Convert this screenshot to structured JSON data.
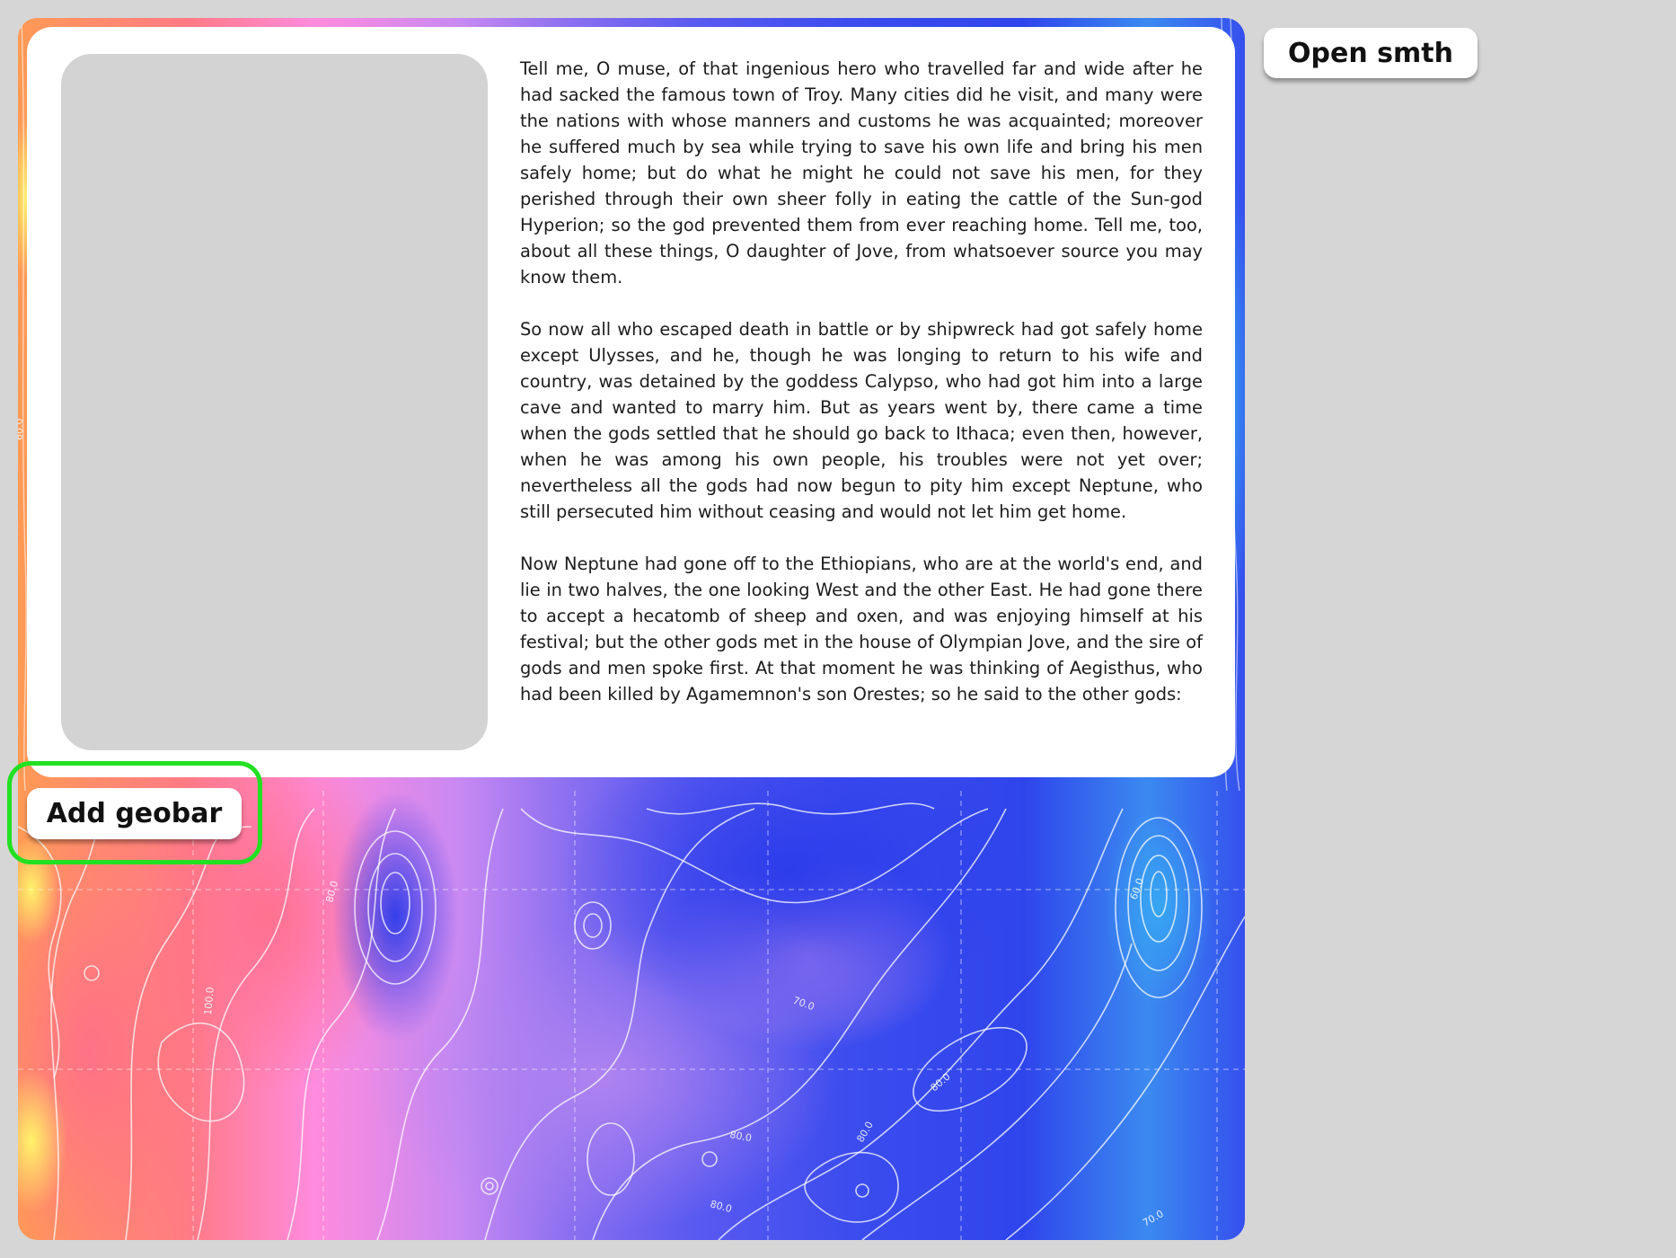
{
  "toolbar": {
    "open_label": "Open smth",
    "add_geobar_label": "Add geobar"
  },
  "article": {
    "paragraphs": [
      "Tell me, O muse, of that ingenious hero who travelled far and wide after he had sacked the famous town of Troy. Many cities did he visit, and many were the nations with whose manners and customs he was acquainted; moreover he suffered much by sea while trying to save his own life and bring his men safely home; but do what he might he could not save his men, for they perished through their own sheer folly in eating the cattle of the Sun-god Hyperion; so the god prevented them from ever reaching home. Tell me, too, about all these things, O daughter of Jove, from whatsoever source you may know them.",
      "So now all who escaped death in battle or by shipwreck had got safely home except Ulysses, and he, though he was longing to return to his wife and country, was detained by the goddess Calypso, who had got him into a large cave and wanted to marry him. But as years went by, there came a time when the gods settled that he should go back to Ithaca; even then, however, when he was among his own people, his troubles were not yet over; nevertheless all the gods had now begun to pity him except Neptune, who still persecuted him without ceasing and would not let him get home.",
      "Now Neptune had gone off to the Ethiopians, who are at the world's end, and lie in two halves, the one looking West and the other East. He had gone there to accept a hecatomb of sheep and oxen, and was enjoying himself at his festival; but the other gods met in the house of Olympian Jove, and the sire of gods and men spoke first. At that moment he was thinking of Aegisthus, who had been killed by Agamemnon's son Orestes; so he said to the other gods:"
    ]
  },
  "map": {
    "contour_labels": [
      "80.0",
      "100.0",
      "70.0",
      "80.0",
      "80.0",
      "80.0",
      "80.0",
      "60.0",
      "70.0",
      "60.0"
    ]
  },
  "colors": {
    "background": "#d6d6d6",
    "highlight": "#22e022",
    "placeholder": "#d3d3d3"
  }
}
